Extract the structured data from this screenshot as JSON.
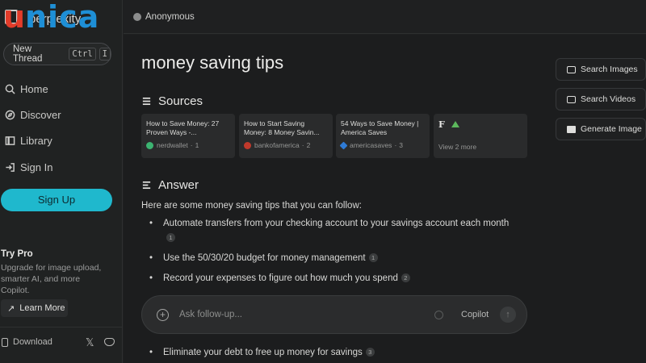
{
  "brand": {
    "name_partial": "perplexity",
    "watermark": "unica"
  },
  "sidebar": {
    "new_thread": {
      "label": "New Thread",
      "kbd": [
        "Ctrl",
        "I"
      ]
    },
    "nav": [
      {
        "label": "Home",
        "icon": "search-icon"
      },
      {
        "label": "Discover",
        "icon": "compass-icon"
      },
      {
        "label": "Library",
        "icon": "library-icon"
      },
      {
        "label": "Sign In",
        "icon": "sign-in-icon"
      }
    ],
    "sign_up": "Sign Up",
    "try_pro": {
      "title": "Try Pro",
      "description": "Upgrade for image upload, smarter AI, and more Copilot.",
      "cta": "Learn More"
    },
    "footer": {
      "download": "Download",
      "x": "𝕏"
    }
  },
  "topbar": {
    "user": "Anonymous"
  },
  "main": {
    "query": "money saving tips",
    "sources_heading": "Sources",
    "sources": [
      {
        "title": "How to Save Money: 27 Proven Ways -...",
        "site": "nerdwallet",
        "num": "1",
        "fav_color": "#3cb371"
      },
      {
        "title": "How to Start Saving Money: 8 Money Savin...",
        "site": "bankofamerica",
        "num": "2",
        "fav_color": "#c0392b"
      },
      {
        "title": "54 Ways to Save Money | America Saves",
        "site": "americasaves",
        "num": "3",
        "fav_color": "#2e7bd6"
      }
    ],
    "view_more": {
      "letter": "F",
      "label": "View 2 more"
    },
    "answer_heading": "Answer",
    "answer_intro": "Here are some money saving tips that you can follow:",
    "bullets": [
      {
        "text": "Automate transfers from your checking account to your savings account each month",
        "cite": "1"
      },
      {
        "text": "Use the 50/30/20 budget for money management",
        "cite": "1"
      },
      {
        "text": "Record your expenses to figure out how much you spend",
        "cite": "2"
      },
      {
        "text": "Eliminate your debt to free up money for savings",
        "cite": "3"
      }
    ],
    "followup": {
      "placeholder": "Ask follow-up...",
      "copilot": "Copilot"
    }
  },
  "right_panel": {
    "buttons": [
      {
        "label": "Search Images",
        "icon": "image-icon"
      },
      {
        "label": "Search Videos",
        "icon": "video-icon"
      },
      {
        "label": "Generate Image",
        "icon": "pro-icon"
      }
    ]
  }
}
